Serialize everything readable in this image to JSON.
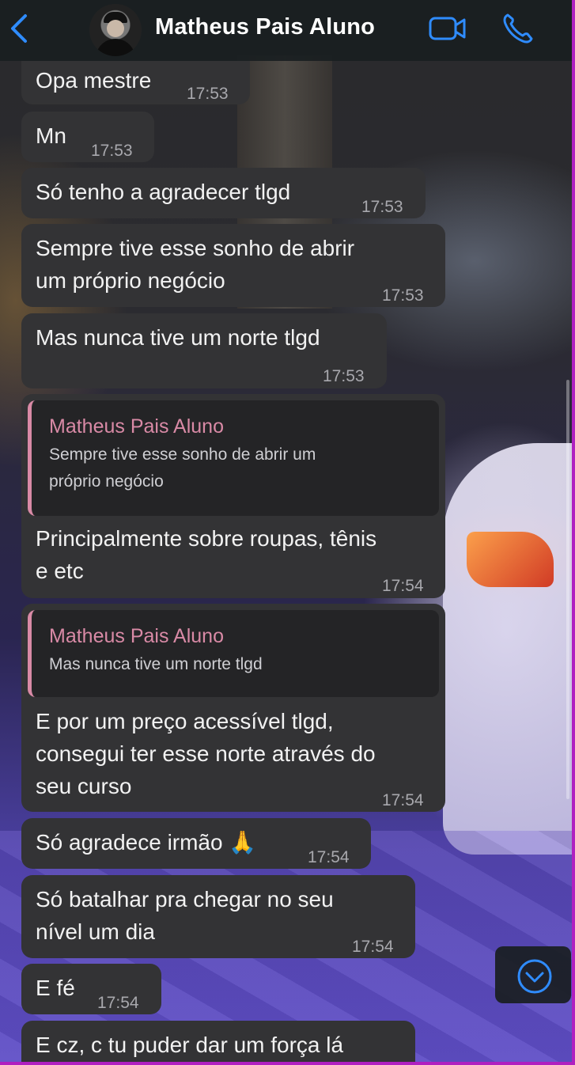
{
  "header": {
    "contact_name": "Matheus Pais Aluno",
    "icons": [
      "back-chevron-icon",
      "video-call-icon",
      "phone-call-icon"
    ]
  },
  "messages": [
    {
      "text": "Opa mestre",
      "time": "17:53"
    },
    {
      "text": "Mn",
      "time": "17:53"
    },
    {
      "text": "Só tenho a agradecer tlgd",
      "time": "17:53"
    },
    {
      "text_lines": [
        "Sempre tive esse sonho de abrir",
        "um próprio negócio"
      ],
      "time": "17:53"
    },
    {
      "text": "Mas nunca tive um norte tlgd",
      "time": "17:53"
    },
    {
      "reply_to": {
        "name": "Matheus Pais Aluno",
        "text_lines": [
          "Sempre tive esse sonho de abrir um",
          "próprio negócio"
        ]
      },
      "text_lines": [
        "Principalmente sobre roupas, tênis",
        "e etc"
      ],
      "time": "17:54"
    },
    {
      "reply_to": {
        "name": "Matheus Pais Aluno",
        "text_lines": [
          "Mas nunca tive um norte tlgd"
        ]
      },
      "text_lines": [
        "E por um preço acessível tlgd,",
        "consegui ter esse norte através do",
        "seu curso"
      ],
      "time": "17:54"
    },
    {
      "text": "Só agradece irmão 🙏",
      "time": "17:54"
    },
    {
      "text_lines": [
        "Só batalhar pra chegar no seu",
        "nível um dia"
      ],
      "time": "17:54"
    },
    {
      "text": "E fé",
      "time": "17:54"
    },
    {
      "text": "E cz, c tu puder dar um força lá"
    }
  ],
  "colors": {
    "bubble": "#333335",
    "quote_accent": "#d98aa6",
    "ios_blue": "#2f8cff"
  }
}
